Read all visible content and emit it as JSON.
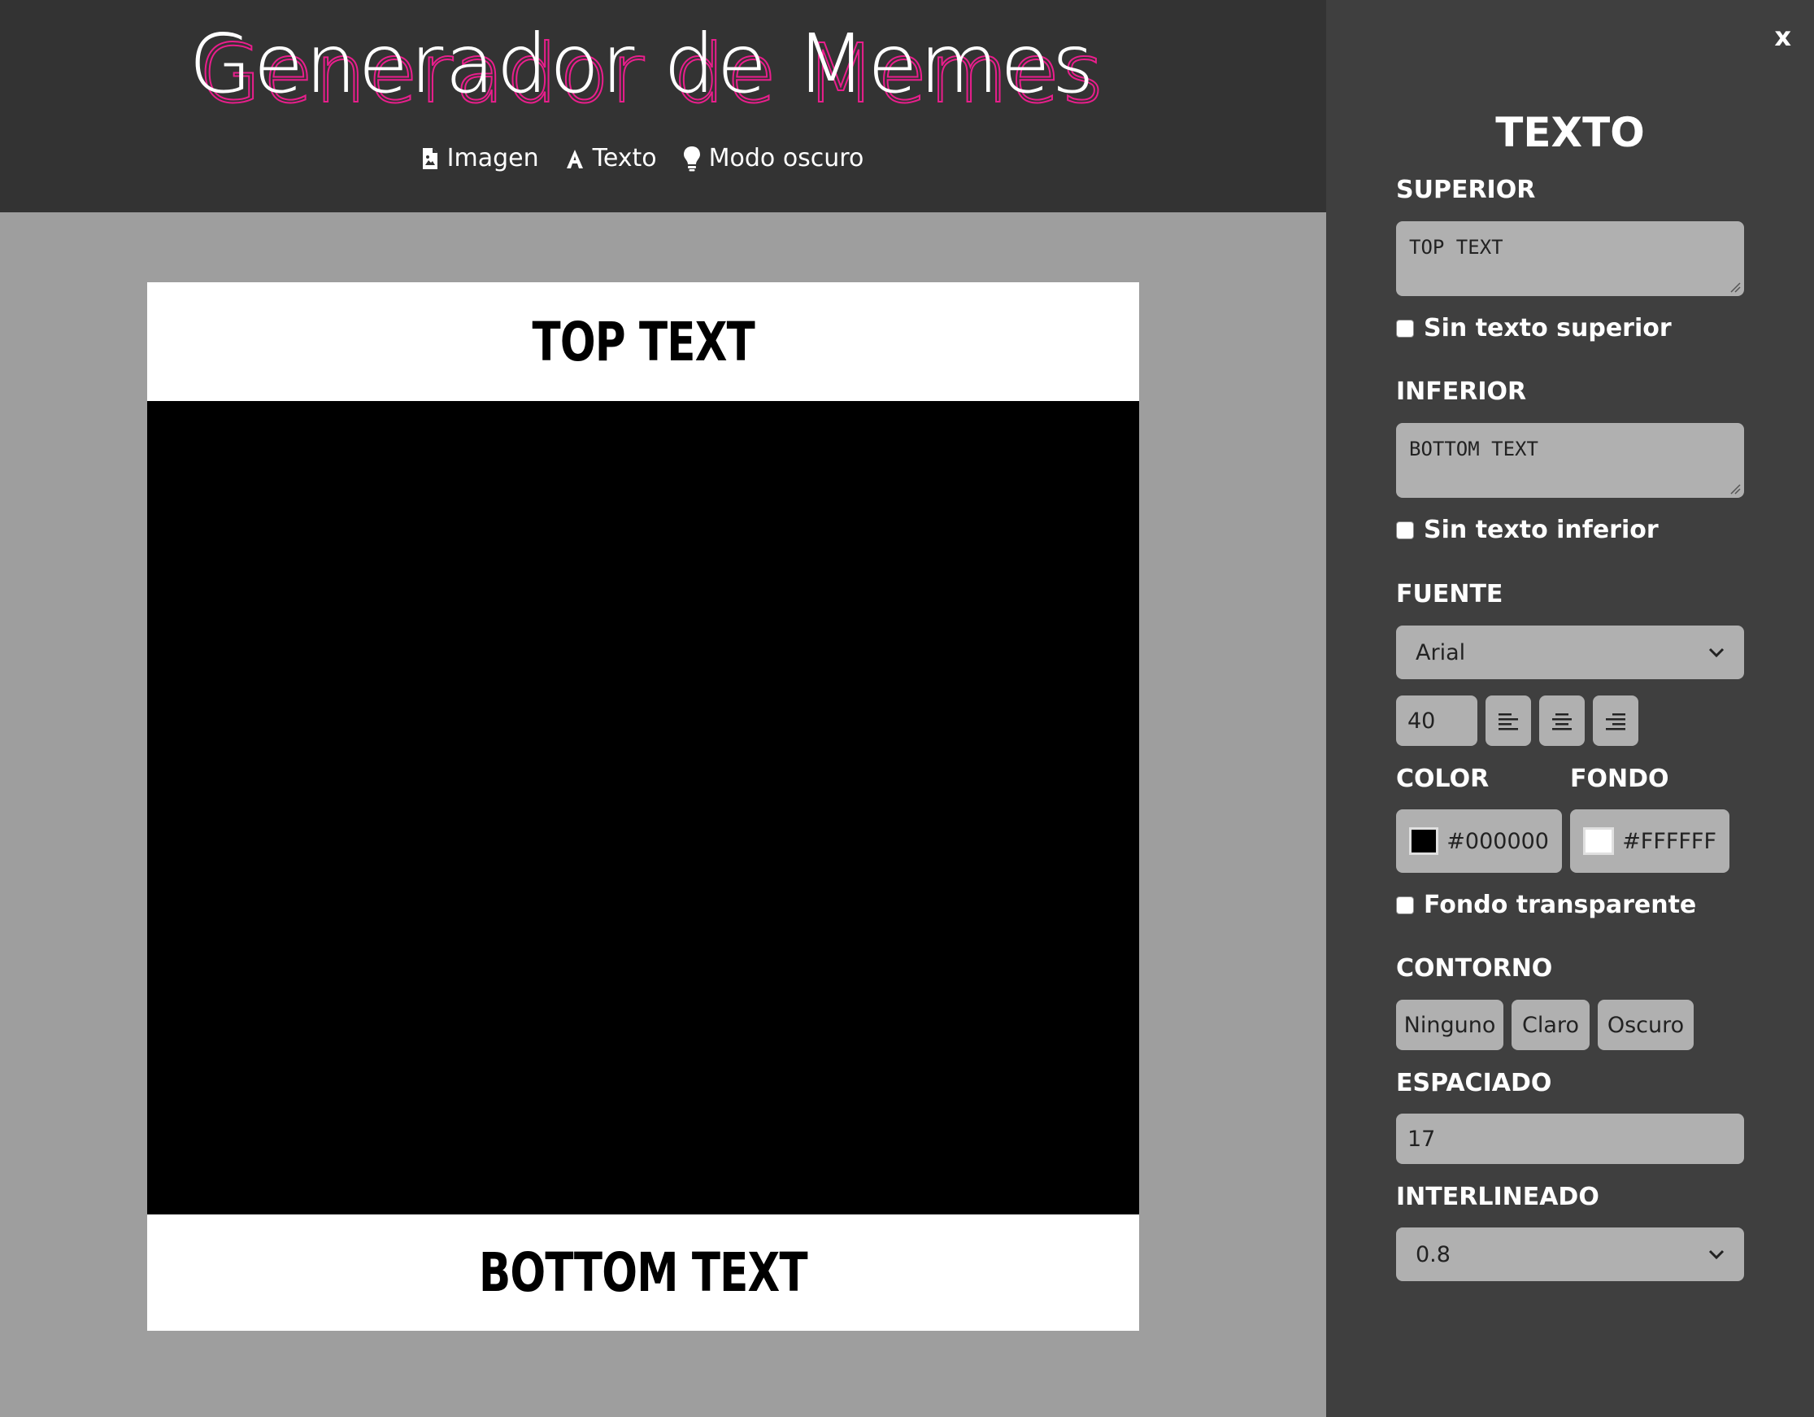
{
  "header": {
    "title": "Generador de Memes",
    "nav": [
      {
        "icon": "image-file-icon",
        "label": "Imagen"
      },
      {
        "icon": "text-icon",
        "label": "Texto"
      },
      {
        "icon": "lightbulb-icon",
        "label": "Modo oscuro"
      }
    ]
  },
  "meme": {
    "top_text": "TOP TEXT",
    "bottom_text": "BOTTOM TEXT",
    "image_color": "#000000",
    "background_color": "#FFFFFF"
  },
  "panel": {
    "close_label": "x",
    "title": "TEXTO",
    "top_label": "SUPERIOR",
    "top_value": "TOP TEXT",
    "no_top_label": "Sin texto superior",
    "bottom_label": "INFERIOR",
    "bottom_value": "BOTTOM TEXT",
    "no_bottom_label": "Sin texto inferior",
    "font_label": "FUENTE",
    "font_value": "Arial",
    "font_size": "40",
    "color_label": "COLOR",
    "bg_label": "FONDO",
    "text_color": "#000000",
    "bg_color": "#FFFFFF",
    "transparent_label": "Fondo transparente",
    "outline_label": "CONTORNO",
    "outline_options": [
      "Ninguno",
      "Claro",
      "Oscuro"
    ],
    "spacing_label": "ESPACIADO",
    "spacing_value": "17",
    "line_height_label": "INTERLINEADO",
    "line_height_value": "0.8"
  },
  "colors": {
    "accent": "#E91E8C",
    "header_bg": "#333333",
    "panel_bg": "#3F3F3F",
    "page_bg": "#9E9E9E"
  }
}
